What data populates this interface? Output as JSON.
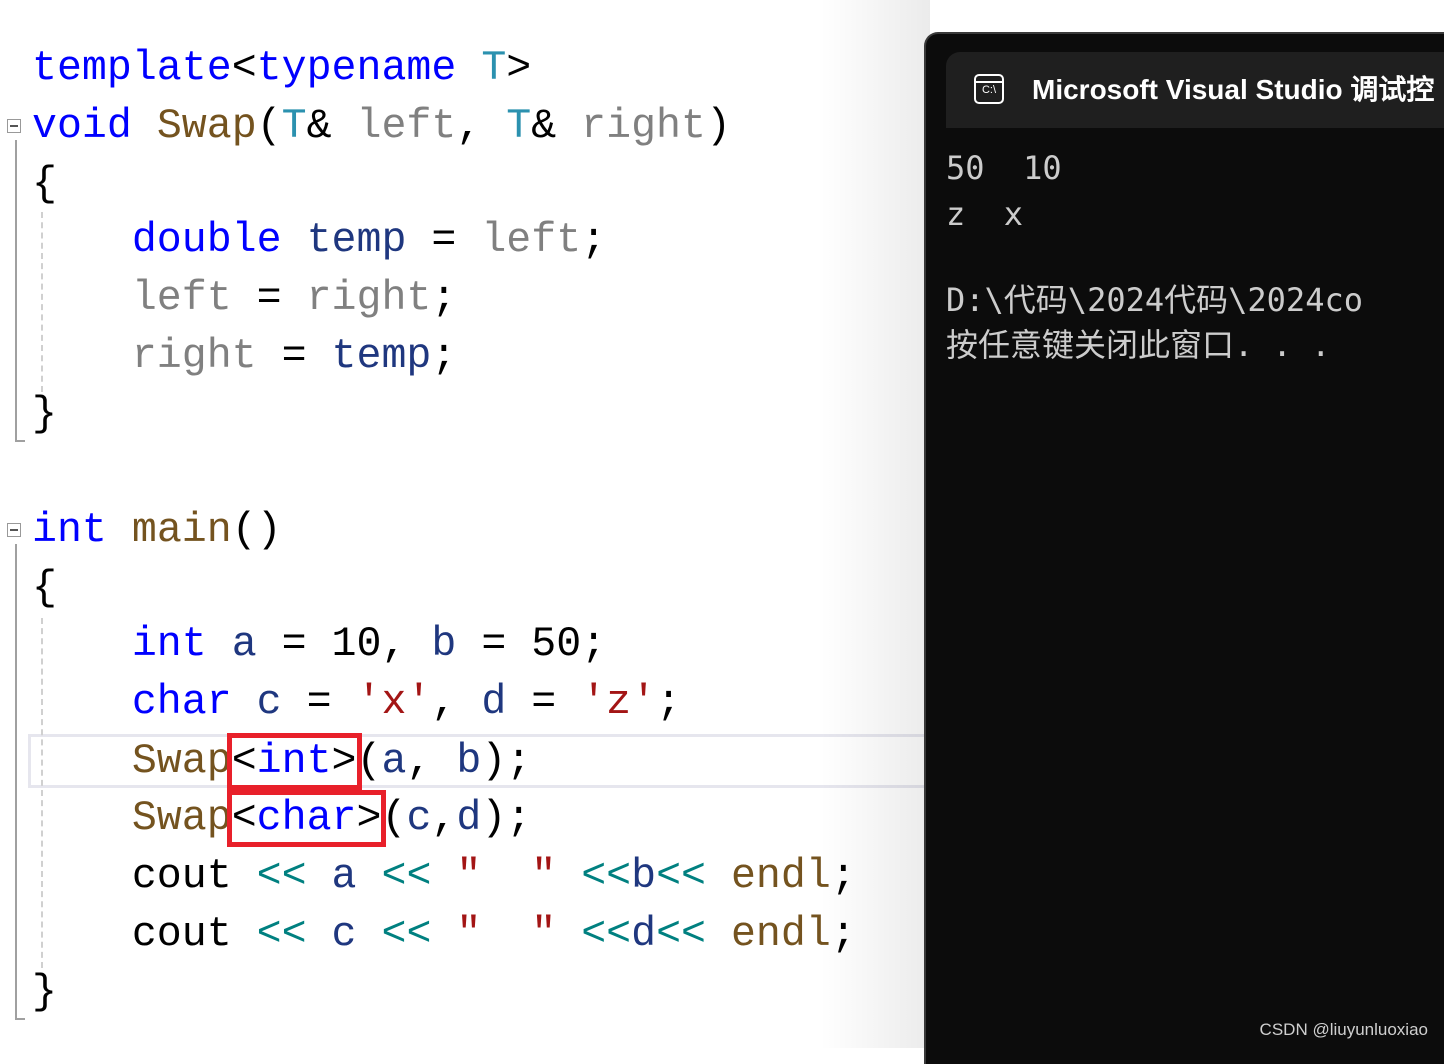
{
  "colors": {
    "keyword": "#0000ff",
    "function": "#74531f",
    "type_param": "#2b91af",
    "parameter": "#808080",
    "variable": "#1f377f",
    "operator": "#008080",
    "string": "#a31515",
    "plain": "#000000",
    "highlight_box": "#e8202a",
    "terminal_bg": "#0c0c0c",
    "terminal_text": "#cccccc"
  },
  "editor": {
    "lines": [
      [
        [
          "template",
          "kw"
        ],
        [
          "<",
          "pl"
        ],
        [
          "typename",
          "kw"
        ],
        [
          " ",
          "pl"
        ],
        [
          "T",
          "tp"
        ],
        [
          ">",
          "pl"
        ]
      ],
      [
        [
          "void",
          "kw"
        ],
        [
          " ",
          "pl"
        ],
        [
          "Swap",
          "fn"
        ],
        [
          "(",
          "pl"
        ],
        [
          "T",
          "tp"
        ],
        [
          "& ",
          "pl"
        ],
        [
          "left",
          "param"
        ],
        [
          ", ",
          "pl"
        ],
        [
          "T",
          "tp"
        ],
        [
          "& ",
          "pl"
        ],
        [
          "right",
          "param"
        ],
        [
          ")",
          "pl"
        ]
      ],
      [
        [
          "{",
          "pl"
        ]
      ],
      [
        [
          "    ",
          "pl"
        ],
        [
          "double",
          "kw"
        ],
        [
          " ",
          "pl"
        ],
        [
          "temp",
          "var"
        ],
        [
          " = ",
          "pl"
        ],
        [
          "left",
          "param"
        ],
        [
          ";",
          "pl"
        ]
      ],
      [
        [
          "    ",
          "pl"
        ],
        [
          "left",
          "param"
        ],
        [
          " = ",
          "pl"
        ],
        [
          "right",
          "param"
        ],
        [
          ";",
          "pl"
        ]
      ],
      [
        [
          "    ",
          "pl"
        ],
        [
          "right",
          "param"
        ],
        [
          " = ",
          "pl"
        ],
        [
          "temp",
          "var"
        ],
        [
          ";",
          "pl"
        ]
      ],
      [
        [
          "}",
          "pl"
        ]
      ],
      [],
      [
        [
          "int",
          "kw"
        ],
        [
          " ",
          "pl"
        ],
        [
          "main",
          "fn"
        ],
        [
          "()",
          "pl"
        ]
      ],
      [
        [
          "{",
          "pl"
        ]
      ],
      [
        [
          "    ",
          "pl"
        ],
        [
          "int",
          "kw"
        ],
        [
          " ",
          "pl"
        ],
        [
          "a",
          "var"
        ],
        [
          " = 10, ",
          "pl"
        ],
        [
          "b",
          "var"
        ],
        [
          " = 50;",
          "pl"
        ]
      ],
      [
        [
          "    ",
          "pl"
        ],
        [
          "char",
          "kw"
        ],
        [
          " ",
          "pl"
        ],
        [
          "c",
          "var"
        ],
        [
          " = ",
          "pl"
        ],
        [
          "'x'",
          "str"
        ],
        [
          ", ",
          "pl"
        ],
        [
          "d",
          "var"
        ],
        [
          " = ",
          "pl"
        ],
        [
          "'z'",
          "str"
        ],
        [
          ";",
          "pl"
        ]
      ],
      [
        [
          "    ",
          "pl"
        ],
        [
          "Swap",
          "fn"
        ],
        [
          "<",
          "pl",
          "boxed"
        ],
        [
          "int",
          "kw"
        ],
        [
          ">",
          "pl",
          "boxed-end"
        ],
        [
          "(",
          "pl"
        ],
        [
          "a",
          "var"
        ],
        [
          ", ",
          "pl"
        ],
        [
          "b",
          "var"
        ],
        [
          ");",
          "pl"
        ]
      ],
      [
        [
          "    ",
          "pl"
        ],
        [
          "Swap",
          "fn"
        ],
        [
          "<",
          "pl",
          "boxed"
        ],
        [
          "char",
          "kw"
        ],
        [
          ">",
          "pl",
          "boxed-end"
        ],
        [
          "(",
          "pl"
        ],
        [
          "c",
          "var"
        ],
        [
          ",",
          "pl"
        ],
        [
          "d",
          "var"
        ],
        [
          ");",
          "pl"
        ]
      ],
      [
        [
          "    ",
          "pl"
        ],
        [
          "cout",
          "pl"
        ],
        [
          " ",
          "pl"
        ],
        [
          "<<",
          "op"
        ],
        [
          " ",
          "pl"
        ],
        [
          "a",
          "var"
        ],
        [
          " ",
          "pl"
        ],
        [
          "<<",
          "op"
        ],
        [
          " ",
          "pl"
        ],
        [
          "\"  \"",
          "str"
        ],
        [
          " ",
          "pl"
        ],
        [
          "<<",
          "op"
        ],
        [
          "b",
          "var"
        ],
        [
          "<<",
          "op"
        ],
        [
          " ",
          "pl"
        ],
        [
          "endl",
          "fn"
        ],
        [
          ";",
          "pl"
        ]
      ],
      [
        [
          "    ",
          "pl"
        ],
        [
          "cout",
          "pl"
        ],
        [
          " ",
          "pl"
        ],
        [
          "<<",
          "op"
        ],
        [
          " ",
          "pl"
        ],
        [
          "c",
          "var"
        ],
        [
          " ",
          "pl"
        ],
        [
          "<<",
          "op"
        ],
        [
          " ",
          "pl"
        ],
        [
          "\"  \"",
          "str"
        ],
        [
          " ",
          "pl"
        ],
        [
          "<<",
          "op"
        ],
        [
          "d",
          "var"
        ],
        [
          "<<",
          "op"
        ],
        [
          " ",
          "pl"
        ],
        [
          "endl",
          "fn"
        ],
        [
          ";",
          "pl"
        ]
      ],
      [
        [
          "}",
          "pl"
        ]
      ]
    ]
  },
  "terminal": {
    "icon": "console-icon",
    "icon_text": "C:\\",
    "title": "Microsoft Visual Studio 调试控",
    "output": [
      "50  10",
      "z  x",
      "",
      "D:\\代码\\2024代码\\2024co",
      "按任意键关闭此窗口. . ."
    ]
  },
  "watermark": "CSDN @liuyunluoxiao"
}
